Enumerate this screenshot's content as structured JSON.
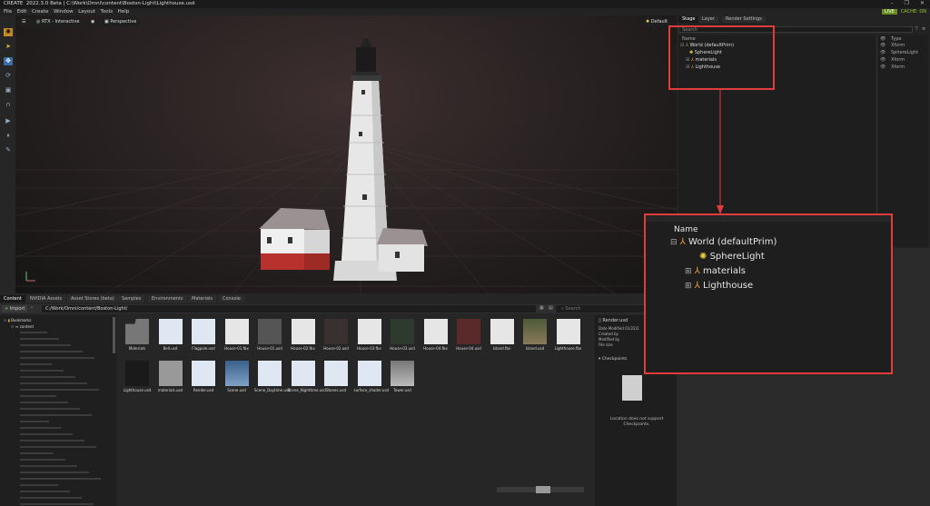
{
  "window": {
    "app_name": "CREATE",
    "version": "2022.3.0",
    "edition": "Beta",
    "path": "C:\\Work\\Omni\\content\\Boston-Light\\Lighthouse.usd",
    "live": "LIVE",
    "cache": "CACHE: ON"
  },
  "menu": [
    "File",
    "Edit",
    "Create",
    "Window",
    "Layout",
    "Tools",
    "Help"
  ],
  "viewport": {
    "render_mode": "RTX - Interactive",
    "camera": "Perspective",
    "right_button": "Default"
  },
  "stage": {
    "tabs": [
      "Stage",
      "Layer",
      "Render Settings"
    ],
    "search_placeholder": "Search",
    "col_name": "Name",
    "col_type": "Type",
    "rows": [
      {
        "name": "World (defaultPrim)",
        "type": "Xform"
      },
      {
        "name": "SphereLight",
        "type": "SphereLight"
      },
      {
        "name": "materials",
        "type": "Xform"
      },
      {
        "name": "Lighthouse",
        "type": "Xform"
      }
    ]
  },
  "zoom": {
    "col_name": "Name",
    "rows": [
      "World (defaultPrim)",
      "SphereLight",
      "materials",
      "Lighthouse"
    ]
  },
  "content": {
    "tabs": [
      "Content",
      "NVIDIA Assets",
      "Asset Stores (beta)",
      "Samples",
      "Environments",
      "Materials",
      "Console"
    ],
    "import_label": "Import",
    "address": "C:/Work/Omni/content/Boston-Light/",
    "search_placeholder": "Search",
    "tree_root": "Bookmarks",
    "tree_content": "content",
    "assets": [
      "Materials",
      "Bell.usd",
      "Flagpole.usd",
      "House-01.fbx",
      "House-01.usd",
      "House-02.fbx",
      "House-02.usd",
      "House-03.fbx",
      "House-03.usd",
      "House-04.fbx",
      "House-04.usd",
      "Island.fbx",
      "Island.usd",
      "Lighthouse.fbx",
      "Lighthouse.usd",
      "materials.usd",
      "Render.usd",
      "Scene.usd",
      "Scene_Daytime.usd",
      "Scene_Nighttime.usd",
      "Stones.usd",
      "surface_shader.usd",
      "Tower.usd"
    ],
    "detail": {
      "filename": "Render.usd",
      "date_modified": "Date Modified 01/22/2",
      "created_by": "Created by",
      "modified_by": "Modified by",
      "file_size": "File size",
      "checkpoints": "Checkpoints",
      "notice": "Location does not support Checkpoints."
    }
  },
  "colors": {
    "accent_red": "#e23b3b",
    "live_green": "#6a8d1f",
    "active_tool": "#3c6eaa"
  }
}
